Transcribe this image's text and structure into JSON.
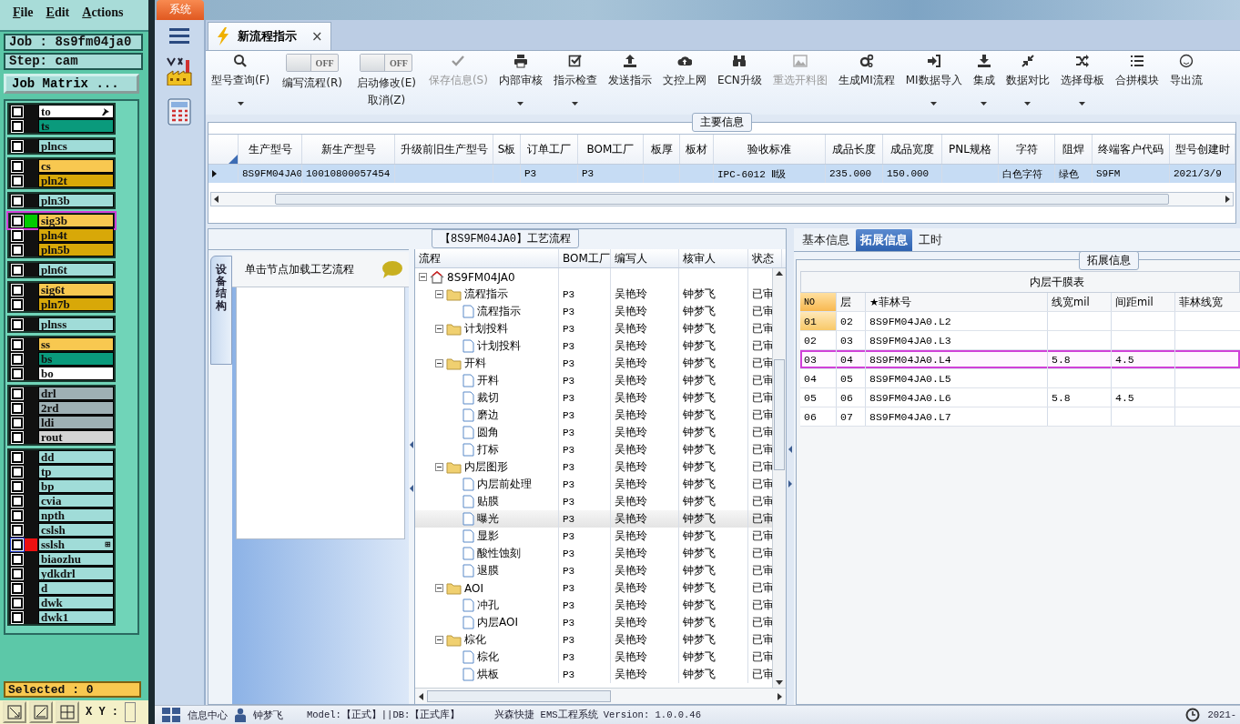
{
  "cam": {
    "menu": [
      "File",
      "Edit",
      "Actions"
    ],
    "job": "Job : 8s9fm04ja0",
    "step": "Step: cam",
    "matrix_button": "Job Matrix ...",
    "layer_groups": [
      [
        {
          "name": "to",
          "color": "#ffffff",
          "checked": false,
          "cursor": true
        },
        {
          "name": "ts",
          "color": "#0a9a7c",
          "checked": false
        }
      ],
      [
        {
          "name": "plncs",
          "color": "#a0dcd8",
          "checked": false
        }
      ],
      [
        {
          "name": "cs",
          "color": "#f8c850",
          "checked": false
        },
        {
          "name": "pln2t",
          "color": "#d8a808",
          "checked": false
        }
      ],
      [
        {
          "name": "pln3b",
          "color": "#a0dcd8",
          "checked": false
        }
      ],
      [
        {
          "name": "sig3b",
          "color": "#f8c850",
          "checked": false,
          "marker": {
            "color": "#00cc00"
          },
          "highlighted": true
        },
        {
          "name": "pln4t",
          "color": "#d8a808",
          "checked": false
        },
        {
          "name": "pln5b",
          "color": "#d8a808",
          "checked": false
        }
      ],
      [
        {
          "name": "pln6t",
          "color": "#a0dcd8",
          "checked": false
        }
      ],
      [
        {
          "name": "sig6t",
          "color": "#f8c850",
          "checked": false
        },
        {
          "name": "pln7b",
          "color": "#d8a808",
          "checked": false
        }
      ],
      [
        {
          "name": "plnss",
          "color": "#a0dcd8",
          "checked": false
        }
      ],
      [
        {
          "name": "ss",
          "color": "#f8c850",
          "checked": false
        },
        {
          "name": "bs",
          "color": "#0a9a7c",
          "checked": false
        },
        {
          "name": "bo",
          "color": "#ffffff",
          "checked": false
        }
      ],
      [
        {
          "name": "drl",
          "color": "#9eb0b4",
          "checked": false
        },
        {
          "name": "2rd",
          "color": "#9eb0b4",
          "checked": false
        },
        {
          "name": "ldi",
          "color": "#9eb0b4",
          "checked": false
        },
        {
          "name": "rout",
          "color": "#d4d4d4",
          "checked": false
        }
      ],
      [
        {
          "name": "dd",
          "color": "#a0dcd8",
          "checked": false
        },
        {
          "name": "tp",
          "color": "#a0dcd8",
          "checked": false
        },
        {
          "name": "bp",
          "color": "#a0dcd8",
          "checked": false
        },
        {
          "name": "cvia",
          "color": "#a0dcd8",
          "checked": false
        },
        {
          "name": "npth",
          "color": "#a0dcd8",
          "checked": false
        },
        {
          "name": "cslsh",
          "color": "#a0dcd8",
          "checked": false
        },
        {
          "name": "sslsh",
          "color": "#a0dcd8",
          "checked": false,
          "marker": {
            "color": "#ee1111"
          },
          "focused": true,
          "badge": "⊞"
        },
        {
          "name": "biaozhu",
          "color": "#a0dcd8",
          "checked": false
        },
        {
          "name": "ydkdrl",
          "color": "#a0dcd8",
          "checked": false
        },
        {
          "name": "d",
          "color": "#a0dcd8",
          "checked": false
        },
        {
          "name": "dwk",
          "color": "#a0dcd8",
          "checked": false
        },
        {
          "name": "dwk1",
          "color": "#a0dcd8",
          "checked": false
        }
      ]
    ],
    "selected_label": "Selected : 0",
    "coords_label": "X Y :"
  },
  "app": {
    "system_tab": "系统",
    "doc_tab": {
      "title": "新流程指示",
      "close": "×"
    },
    "toolbar": [
      {
        "kind": "button",
        "label": "型号查询(F)",
        "dropdown": true,
        "disabled": false
      },
      {
        "kind": "toggle",
        "label": "编写流程(R)",
        "toggle_text": "OFF",
        "on": false
      },
      {
        "kind": "toggle",
        "label": "启动修改(E)",
        "sublabel": "取消(Z)",
        "toggle_text": "OFF",
        "on": false
      },
      {
        "kind": "button",
        "label": "保存信息(S)",
        "dropdown": false,
        "disabled": true
      },
      {
        "kind": "button",
        "label": "内部审核",
        "dropdown": true,
        "disabled": false
      },
      {
        "kind": "button",
        "label": "指示检查",
        "dropdown": true,
        "disabled": false
      },
      {
        "kind": "button",
        "label": "发送指示",
        "dropdown": false,
        "disabled": false
      },
      {
        "kind": "button",
        "label": "文控上网",
        "dropdown": false,
        "disabled": false
      },
      {
        "kind": "button",
        "label": "ECN升级",
        "dropdown": false,
        "disabled": false
      },
      {
        "kind": "button",
        "label": "重选开料图",
        "dropdown": false,
        "disabled": true
      },
      {
        "kind": "button",
        "label": "生成MI流程",
        "dropdown": false,
        "disabled": false
      },
      {
        "kind": "button",
        "label": "MI数据导入",
        "dropdown": true,
        "disabled": false
      },
      {
        "kind": "button",
        "label": "集成",
        "dropdown": true,
        "disabled": false
      },
      {
        "kind": "button",
        "label": "数据对比",
        "dropdown": true,
        "disabled": false
      },
      {
        "kind": "button",
        "label": "选择母板",
        "dropdown": true,
        "disabled": false
      },
      {
        "kind": "button",
        "label": "合拼模块",
        "dropdown": false,
        "disabled": false
      },
      {
        "kind": "button",
        "label": "导出流",
        "dropdown": false,
        "disabled": false
      }
    ],
    "main_info": {
      "title": "主要信息",
      "columns": [
        "生产型号",
        "新生产型号",
        "升级前旧生产型号",
        "S板",
        "订单工厂",
        "BOM工厂",
        "板厚",
        "板材",
        "验收标准",
        "成品长度",
        "成品宽度",
        "PNL规格",
        "字符",
        "阻焊",
        "终端客户代码",
        "型号创建时"
      ],
      "rows": [
        {
          "selected": true,
          "cells": {
            "0": "8S9FM04JA0",
            "1": "10010800057454",
            "4": "P3",
            "5": "P3",
            "8": "IPC-6012 Ⅱ级",
            "9": "235.000",
            "10": "150.000",
            "12": "白色字符",
            "13": "绿色",
            "14": "S9FM",
            "15": "2021/3/9"
          }
        }
      ]
    },
    "process": {
      "title": "【8S9FM04JA0】工艺流程",
      "side_tab": "设备结构",
      "hint": "单击节点加载工艺流程",
      "columns": [
        "流程",
        "BOM工厂",
        "编写人",
        "核审人",
        "状态"
      ],
      "tree": [
        {
          "kind": "root",
          "label": "8S9FM04JA0",
          "expanded": true,
          "selected": false,
          "children": [
            {
              "kind": "folder",
              "label": "流程指示",
              "bom": "P3",
              "author": "吴艳玲",
              "reviewer": "钟梦飞",
              "status": "已审",
              "expanded": true,
              "selected": false,
              "children": [
                {
                  "kind": "file",
                  "label": "流程指示",
                  "bom": "P3",
                  "author": "吴艳玲",
                  "reviewer": "钟梦飞",
                  "status": "已审",
                  "selected": false
                }
              ]
            },
            {
              "kind": "folder",
              "label": "计划投料",
              "bom": "P3",
              "author": "吴艳玲",
              "reviewer": "钟梦飞",
              "status": "已审",
              "expanded": true,
              "selected": false,
              "children": [
                {
                  "kind": "file",
                  "label": "计划投料",
                  "bom": "P3",
                  "author": "吴艳玲",
                  "reviewer": "钟梦飞",
                  "status": "已审",
                  "selected": false
                }
              ]
            },
            {
              "kind": "folder",
              "label": "开料",
              "bom": "P3",
              "author": "吴艳玲",
              "reviewer": "钟梦飞",
              "status": "已审",
              "expanded": true,
              "selected": false,
              "children": [
                {
                  "kind": "file",
                  "label": "开料",
                  "bom": "P3",
                  "author": "吴艳玲",
                  "reviewer": "钟梦飞",
                  "status": "已审",
                  "selected": false
                },
                {
                  "kind": "file",
                  "label": "裁切",
                  "bom": "P3",
                  "author": "吴艳玲",
                  "reviewer": "钟梦飞",
                  "status": "已审",
                  "selected": false
                },
                {
                  "kind": "file",
                  "label": "磨边",
                  "bom": "P3",
                  "author": "吴艳玲",
                  "reviewer": "钟梦飞",
                  "status": "已审",
                  "selected": false
                },
                {
                  "kind": "file",
                  "label": "圆角",
                  "bom": "P3",
                  "author": "吴艳玲",
                  "reviewer": "钟梦飞",
                  "status": "已审",
                  "selected": false
                },
                {
                  "kind": "file",
                  "label": "打标",
                  "bom": "P3",
                  "author": "吴艳玲",
                  "reviewer": "钟梦飞",
                  "status": "已审",
                  "selected": false
                }
              ]
            },
            {
              "kind": "folder",
              "label": "内层图形",
              "bom": "P3",
              "author": "吴艳玲",
              "reviewer": "钟梦飞",
              "status": "已审",
              "expanded": true,
              "selected": false,
              "children": [
                {
                  "kind": "file",
                  "label": "内层前处理",
                  "bom": "P3",
                  "author": "吴艳玲",
                  "reviewer": "钟梦飞",
                  "status": "已审",
                  "selected": false
                },
                {
                  "kind": "file",
                  "label": "贴膜",
                  "bom": "P3",
                  "author": "吴艳玲",
                  "reviewer": "钟梦飞",
                  "status": "已审",
                  "selected": false
                },
                {
                  "kind": "file",
                  "label": "曝光",
                  "bom": "P3",
                  "author": "吴艳玲",
                  "reviewer": "钟梦飞",
                  "status": "已审",
                  "selected": true
                },
                {
                  "kind": "file",
                  "label": "显影",
                  "bom": "P3",
                  "author": "吴艳玲",
                  "reviewer": "钟梦飞",
                  "status": "已审",
                  "selected": false
                },
                {
                  "kind": "file",
                  "label": "酸性蚀刻",
                  "bom": "P3",
                  "author": "吴艳玲",
                  "reviewer": "钟梦飞",
                  "status": "已审",
                  "selected": false
                },
                {
                  "kind": "file",
                  "label": "退膜",
                  "bom": "P3",
                  "author": "吴艳玲",
                  "reviewer": "钟梦飞",
                  "status": "已审",
                  "selected": false
                }
              ]
            },
            {
              "kind": "folder",
              "label": "AOI",
              "bom": "P3",
              "author": "吴艳玲",
              "reviewer": "钟梦飞",
              "status": "已审",
              "expanded": true,
              "selected": false,
              "children": [
                {
                  "kind": "file",
                  "label": "冲孔",
                  "bom": "P3",
                  "author": "吴艳玲",
                  "reviewer": "钟梦飞",
                  "status": "已审",
                  "selected": false
                },
                {
                  "kind": "file",
                  "label": "内层AOI",
                  "bom": "P3",
                  "author": "吴艳玲",
                  "reviewer": "钟梦飞",
                  "status": "已审",
                  "selected": false
                }
              ]
            },
            {
              "kind": "folder",
              "label": "棕化",
              "bom": "P3",
              "author": "吴艳玲",
              "reviewer": "钟梦飞",
              "status": "已审",
              "expanded": true,
              "selected": false,
              "children": [
                {
                  "kind": "file",
                  "label": "棕化",
                  "bom": "P3",
                  "author": "吴艳玲",
                  "reviewer": "钟梦飞",
                  "status": "已审",
                  "selected": false
                },
                {
                  "kind": "file",
                  "label": "烘板",
                  "bom": "P3",
                  "author": "吴艳玲",
                  "reviewer": "钟梦飞",
                  "status": "已审",
                  "selected": false
                }
              ]
            }
          ]
        }
      ]
    },
    "detail": {
      "tabs": [
        {
          "label": "基本信息",
          "selected": false
        },
        {
          "label": "拓展信息",
          "selected": true
        },
        {
          "label": "工时",
          "selected": false
        }
      ],
      "group_title": "拓展信息",
      "table_title": "内层干膜表",
      "columns": [
        "NO",
        "层",
        "★菲林号",
        "线宽mil",
        "间距mil",
        "菲林线宽"
      ],
      "rows": [
        {
          "selected": true,
          "highlighted": false,
          "cells": {
            "0": "01",
            "1": "02",
            "2": "8S9FM04JA0.L2"
          }
        },
        {
          "selected": false,
          "highlighted": false,
          "cells": {
            "0": "02",
            "1": "03",
            "2": "8S9FM04JA0.L3"
          }
        },
        {
          "selected": false,
          "highlighted": true,
          "cells": {
            "0": "03",
            "1": "04",
            "2": "8S9FM04JA0.L4",
            "3": "5.8",
            "4": "4.5"
          }
        },
        {
          "selected": false,
          "highlighted": false,
          "cells": {
            "0": "04",
            "1": "05",
            "2": "8S9FM04JA0.L5"
          }
        },
        {
          "selected": false,
          "highlighted": false,
          "cells": {
            "0": "05",
            "1": "06",
            "2": "8S9FM04JA0.L6",
            "3": "5.8",
            "4": "4.5"
          }
        },
        {
          "selected": false,
          "highlighted": false,
          "cells": {
            "0": "06",
            "1": "07",
            "2": "8S9FM04JA0.L7"
          }
        }
      ]
    },
    "status": {
      "info_center": "信息中心",
      "user": "钟梦飞",
      "model": "Model:【正式】||DB:【正式库】",
      "system": "兴森快捷 EMS工程系统 Version: 1.0.0.46",
      "date": "2021-"
    }
  }
}
